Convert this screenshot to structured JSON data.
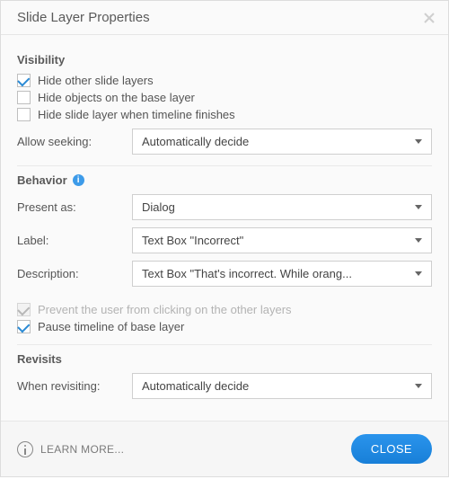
{
  "dialog": {
    "title": "Slide Layer Properties"
  },
  "visibility": {
    "heading": "Visibility",
    "opt_hide_other": "Hide other slide layers",
    "opt_hide_base_objects": "Hide objects on the base layer",
    "opt_hide_on_timeline_finish": "Hide slide layer when timeline finishes",
    "allow_seeking_label": "Allow seeking:",
    "allow_seeking_value": "Automatically decide"
  },
  "behavior": {
    "heading": "Behavior",
    "present_as_label": "Present as:",
    "present_as_value": "Dialog",
    "label_label": "Label:",
    "label_value": "Text Box \"Incorrect\"",
    "description_label": "Description:",
    "description_value": "Text Box \"That's incorrect. While orang...",
    "opt_prevent_click": "Prevent the user from clicking on the other layers",
    "opt_pause_base_timeline": "Pause timeline of base layer"
  },
  "revisits": {
    "heading": "Revisits",
    "when_revisiting_label": "When revisiting:",
    "when_revisiting_value": "Automatically decide"
  },
  "footer": {
    "learn_more": "LEARN MORE...",
    "close": "CLOSE"
  }
}
